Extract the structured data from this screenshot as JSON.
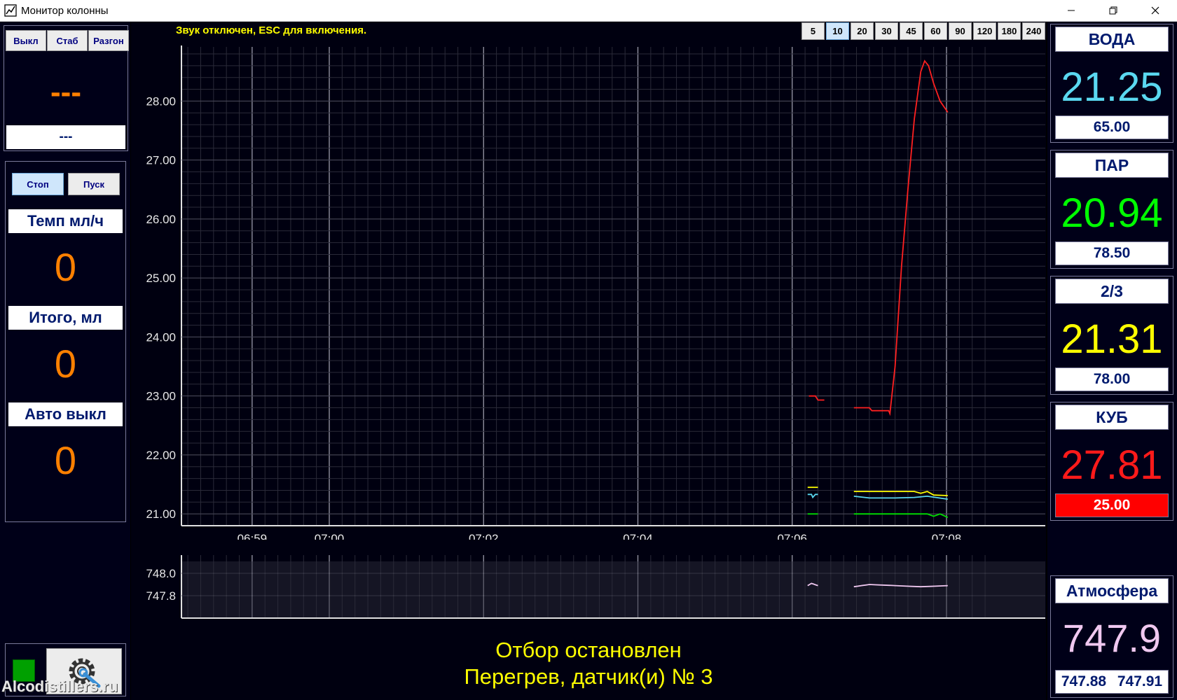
{
  "window": {
    "title": "Монитор колонны"
  },
  "mode_buttons": [
    "Выкл",
    "Стаб",
    "Разгон"
  ],
  "mode_display": {
    "value": "---",
    "sub": "---"
  },
  "control_buttons": {
    "stop": "Стоп",
    "start": "Пуск"
  },
  "rate": {
    "label": "Темп мл/ч",
    "value": "0"
  },
  "total": {
    "label": "Итого, мл",
    "value": "0"
  },
  "auto_off": {
    "label": "Авто выкл",
    "value": "0"
  },
  "sound_message": "Звук отключен, ESC для включения.",
  "zoom_buttons": [
    "5",
    "10",
    "20",
    "30",
    "45",
    "60",
    "90",
    "120",
    "180",
    "240"
  ],
  "zoom_selected": "10",
  "status": {
    "line1": "Отбор остановлен",
    "line2": "Перегрев, датчик(и) № 3"
  },
  "sensors": [
    {
      "name": "ВОДА",
      "value": "21.25",
      "setpoint": "65.00",
      "color": "#5ad8f0",
      "alarm": false
    },
    {
      "name": "ПАР",
      "value": "20.94",
      "setpoint": "78.50",
      "color": "#00ff00",
      "alarm": false
    },
    {
      "name": "2/3",
      "value": "21.31",
      "setpoint": "78.00",
      "color": "#ffff00",
      "alarm": false
    },
    {
      "name": "КУБ",
      "value": "27.81",
      "setpoint": "25.00",
      "color": "#ff1a1a",
      "alarm": true
    }
  ],
  "atmosphere": {
    "name": "Атмосфера",
    "value": "747.9",
    "min": "747.88",
    "max": "747.91",
    "color": "#f0c8f0"
  },
  "watermark": "Alcodistillers.ru",
  "chart_data": [
    {
      "type": "line",
      "x_ticks": [
        "06:59",
        "07:00",
        "07:02",
        "07:04",
        "07:06",
        "07:08"
      ],
      "ylim": [
        20.8,
        28.8
      ],
      "y_ticks": [
        "21.00",
        "22.00",
        "23.00",
        "24.00",
        "25.00",
        "26.00",
        "27.00",
        "28.00"
      ],
      "grid": true,
      "series": [
        {
          "color": "#ff2020",
          "segments": [
            [
              [
                "07:06:13",
                23.0
              ],
              [
                "07:06:18",
                23.0
              ],
              [
                "07:06:20",
                22.93
              ],
              [
                "07:06:25",
                22.93
              ]
            ],
            [
              [
                "07:06:48",
                22.8
              ],
              [
                "07:07:00",
                22.8
              ],
              [
                "07:07:02",
                22.75
              ],
              [
                "07:07:15",
                22.75
              ],
              [
                "07:07:16",
                22.7
              ],
              [
                "07:07:20",
                23.5
              ],
              [
                "07:07:25",
                25.2
              ],
              [
                "07:07:30",
                26.5
              ],
              [
                "07:07:35",
                27.7
              ],
              [
                "07:07:40",
                28.5
              ],
              [
                "07:07:43",
                28.68
              ],
              [
                "07:07:46",
                28.6
              ],
              [
                "07:07:50",
                28.3
              ],
              [
                "07:07:55",
                28.0
              ],
              [
                "07:08:01",
                27.81
              ]
            ]
          ]
        },
        {
          "color": "#ffff00",
          "segments": [
            [
              [
                "07:06:12",
                21.45
              ],
              [
                "07:06:20",
                21.45
              ]
            ],
            [
              [
                "07:06:48",
                21.38
              ],
              [
                "07:07:35",
                21.38
              ],
              [
                "07:07:40",
                21.35
              ],
              [
                "07:07:45",
                21.38
              ],
              [
                "07:07:50",
                21.32
              ],
              [
                "07:08:01",
                21.31
              ]
            ]
          ]
        },
        {
          "color": "#5ad8f0",
          "segments": [
            [
              [
                "07:06:12",
                21.33
              ],
              [
                "07:06:15",
                21.33
              ],
              [
                "07:06:16",
                21.28
              ],
              [
                "07:06:18",
                21.33
              ],
              [
                "07:06:20",
                21.33
              ]
            ],
            [
              [
                "07:06:48",
                21.3
              ],
              [
                "07:07:00",
                21.27
              ],
              [
                "07:07:20",
                21.27
              ],
              [
                "07:07:35",
                21.28
              ],
              [
                "07:07:45",
                21.3
              ],
              [
                "07:08:01",
                21.25
              ]
            ]
          ]
        },
        {
          "color": "#00e000",
          "segments": [
            [
              [
                "07:06:12",
                21.0
              ],
              [
                "07:06:20",
                21.0
              ]
            ],
            [
              [
                "07:06:48",
                21.0
              ],
              [
                "07:07:45",
                21.0
              ],
              [
                "07:07:50",
                20.96
              ],
              [
                "07:07:55",
                21.0
              ],
              [
                "07:08:01",
                20.94
              ]
            ]
          ]
        }
      ]
    },
    {
      "type": "line",
      "ylim": [
        747.6,
        748.1
      ],
      "y_ticks": [
        "748.0",
        "747.8"
      ],
      "grid": true,
      "series": [
        {
          "color": "#f0c8f0",
          "segments": [
            [
              [
                "07:06:12",
                747.89
              ],
              [
                "07:06:15",
                747.91
              ],
              [
                "07:06:20",
                747.89
              ]
            ],
            [
              [
                "07:06:48",
                747.88
              ],
              [
                "07:07:00",
                747.9
              ],
              [
                "07:07:20",
                747.89
              ],
              [
                "07:07:40",
                747.88
              ],
              [
                "07:08:01",
                747.89
              ]
            ]
          ]
        }
      ]
    }
  ]
}
